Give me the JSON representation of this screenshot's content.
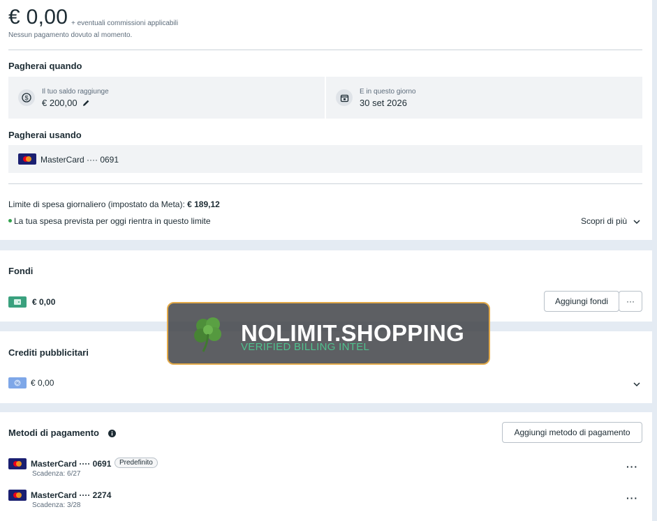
{
  "summary": {
    "amount": "€ 0,00",
    "fees_note": "+ eventuali commissioni applicabili",
    "no_due": "Nessun pagamento dovuto al momento."
  },
  "pay_when": {
    "heading": "Pagherai quando",
    "threshold_label": "Il tuo saldo raggiunge",
    "threshold_value": "€ 200,00",
    "date_label": "E in questo giorno",
    "date_value": "30 set 2026"
  },
  "pay_using": {
    "heading": "Pagherai usando",
    "card": "MasterCard ···· 0691"
  },
  "daily_limit": {
    "text": "Limite di spesa giornaliero (impostato da Meta): ",
    "amount": "€ 189,12",
    "status": "La tua spesa prevista per oggi rientra in questo limite",
    "learn_more": "Scopri di più",
    "status_color": "#31a24c"
  },
  "funds": {
    "heading": "Fondi",
    "value": "€ 0,00",
    "add_button": "Aggiungi fondi",
    "more": "···"
  },
  "ad_credits": {
    "heading": "Crediti pubblicitari",
    "value": "€ 0,00"
  },
  "payment_methods": {
    "heading": "Metodi di pagamento",
    "add_button": "Aggiungi metodo di pagamento",
    "methods": [
      {
        "name": "MasterCard ···· 0691",
        "expiry": "Scadenza: 6/27",
        "badge": "Predefinito",
        "more": "···"
      },
      {
        "name": "MasterCard ···· 2274",
        "expiry": "Scadenza: 3/28",
        "more": "···"
      }
    ]
  },
  "watermark": {
    "title": "NOLIMIT.SHOPPING",
    "subtitle": "VERIFIED BILLING INTEL",
    "border_color": "#e2a948",
    "subtitle_color": "#4fc08d"
  }
}
